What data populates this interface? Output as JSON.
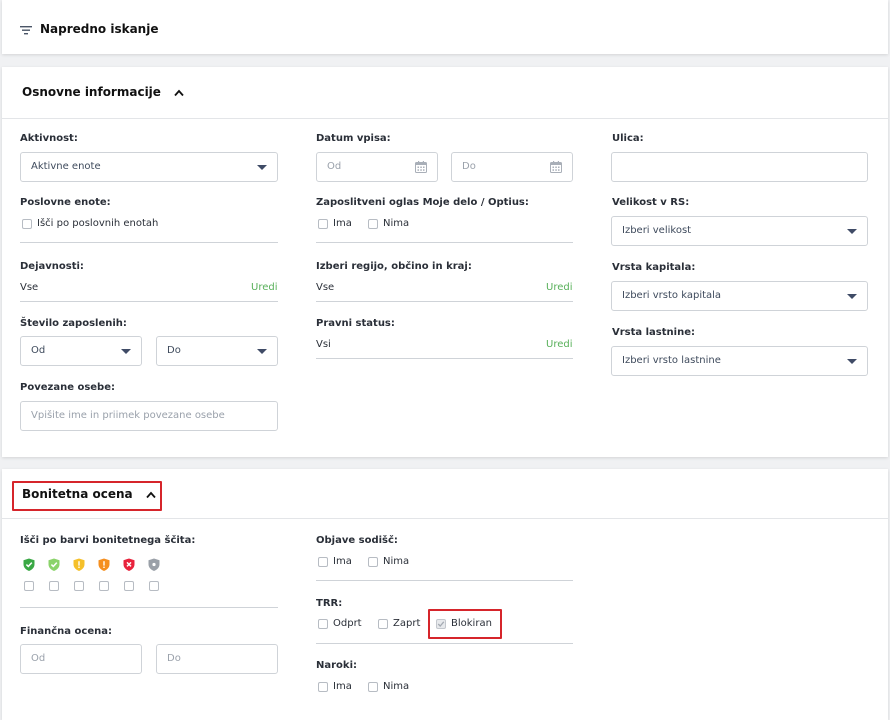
{
  "header": {
    "title": "Napredno iskanje",
    "icon": "filter-icon"
  },
  "osnovne": {
    "title": "Osnovne informacije",
    "aktivnost": {
      "label": "Aktivnost:",
      "value": "Aktivne enote"
    },
    "poslovne": {
      "label": "Poslovne enote:",
      "option": "Išči po poslovnih enotah"
    },
    "dejavnosti": {
      "label": "Dejavnosti:",
      "value": "Vse",
      "edit": "Uredi"
    },
    "stevilo": {
      "label": "Število zaposlenih:",
      "from": "Od",
      "to": "Do"
    },
    "povezane": {
      "label": "Povezane osebe:",
      "placeholder": "Vpišite ime in priimek povezane osebe"
    },
    "datum": {
      "label": "Datum vpisa:",
      "from": "Od",
      "to": "Do"
    },
    "oglas": {
      "label": "Zaposlitveni oglas Moje delo / Optius:",
      "opt1": "Ima",
      "opt2": "Nima"
    },
    "regija": {
      "label": "Izberi regijo, občino in kraj:",
      "value": "Vse",
      "edit": "Uredi"
    },
    "pravni": {
      "label": "Pravni status:",
      "value": "Vsi",
      "edit": "Uredi"
    },
    "ulica": {
      "label": "Ulica:"
    },
    "velikost": {
      "label": "Velikost v RS:",
      "value": "Izberi velikost"
    },
    "kapital": {
      "label": "Vrsta kapitala:",
      "value": "Izberi vrsto kapitala"
    },
    "lastnina": {
      "label": "Vrsta lastnine:",
      "value": "Izberi vrsto lastnine"
    }
  },
  "bonitetna": {
    "title": "Bonitetna ocena",
    "barve": {
      "label": "Išči po barvi bonitetnega ščita:"
    },
    "shields": [
      {
        "color": "#3aa845",
        "icon": "check-shield-icon"
      },
      {
        "color": "#8bd36b",
        "icon": "check-shield-icon"
      },
      {
        "color": "#f5c02a",
        "icon": "exclamation-shield-icon"
      },
      {
        "color": "#f58f1f",
        "icon": "exclamation-shield-icon"
      },
      {
        "color": "#e8233c",
        "icon": "x-shield-icon"
      },
      {
        "color": "#9aa0a8",
        "icon": "dot-shield-icon"
      }
    ],
    "financna": {
      "label": "Finančna ocena:",
      "from": "Od",
      "to": "Do"
    },
    "objave": {
      "label": "Objave sodišč:",
      "opt1": "Ima",
      "opt2": "Nima"
    },
    "trr": {
      "label": "TRR:",
      "opt1": "Odprt",
      "opt2": "Zaprt",
      "opt3": "Blokiran"
    },
    "naroki": {
      "label": "Naroki:",
      "opt1": "Ima",
      "opt2": "Nima"
    }
  }
}
